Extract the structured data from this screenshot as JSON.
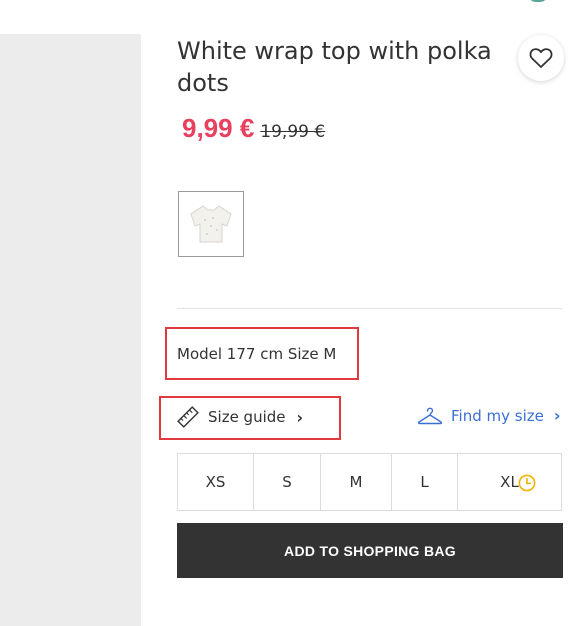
{
  "product": {
    "title": "White wrap top with polka dots",
    "price_current": "9,99 €",
    "price_original": "19,99 €"
  },
  "model_info": "Model 177 cm Size M",
  "links": {
    "size_guide": "Size guide",
    "find_my_size": "Find my size"
  },
  "sizes": [
    {
      "label": "XS"
    },
    {
      "label": "S"
    },
    {
      "label": "M"
    },
    {
      "label": "L"
    },
    {
      "label": "XL",
      "status_icon": "clock-icon"
    }
  ],
  "add_to_bag": "ADD TO SHOPPING BAG",
  "icons": {
    "wishlist": "heart-icon",
    "size_guide": "ruler-icon",
    "find_my_size": "hanger-icon",
    "low_stock": "clock-icon"
  },
  "colors": {
    "sale_price": "#e8405f",
    "link": "#3b6fd6",
    "button_bg": "#333333",
    "highlight_box": "#e03a3e",
    "clock": "#f0b400"
  }
}
